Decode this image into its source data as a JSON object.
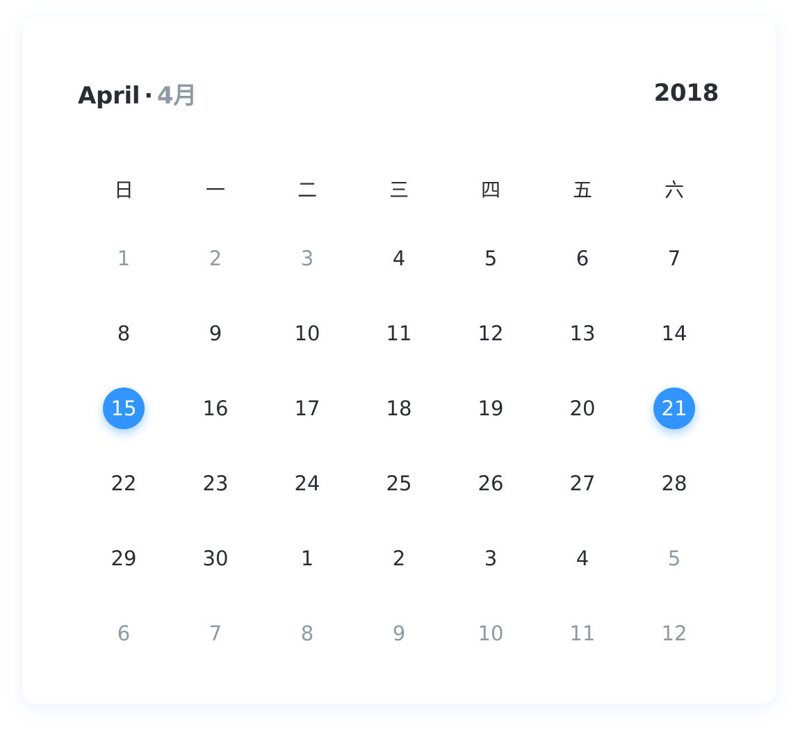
{
  "header": {
    "month": "April",
    "separator": "·",
    "month_cn": "4月",
    "year": "2018"
  },
  "weekdays": [
    "日",
    "一",
    "二",
    "三",
    "四",
    "五",
    "六"
  ],
  "weeks": [
    [
      {
        "label": "1",
        "muted": true,
        "selected": false
      },
      {
        "label": "2",
        "muted": true,
        "selected": false
      },
      {
        "label": "3",
        "muted": true,
        "selected": false
      },
      {
        "label": "4",
        "muted": false,
        "selected": false
      },
      {
        "label": "5",
        "muted": false,
        "selected": false
      },
      {
        "label": "6",
        "muted": false,
        "selected": false
      },
      {
        "label": "7",
        "muted": false,
        "selected": false
      }
    ],
    [
      {
        "label": "8",
        "muted": false,
        "selected": false
      },
      {
        "label": "9",
        "muted": false,
        "selected": false
      },
      {
        "label": "10",
        "muted": false,
        "selected": false
      },
      {
        "label": "11",
        "muted": false,
        "selected": false
      },
      {
        "label": "12",
        "muted": false,
        "selected": false
      },
      {
        "label": "13",
        "muted": false,
        "selected": false
      },
      {
        "label": "14",
        "muted": false,
        "selected": false
      }
    ],
    [
      {
        "label": "15",
        "muted": false,
        "selected": true
      },
      {
        "label": "16",
        "muted": false,
        "selected": false
      },
      {
        "label": "17",
        "muted": false,
        "selected": false
      },
      {
        "label": "18",
        "muted": false,
        "selected": false
      },
      {
        "label": "19",
        "muted": false,
        "selected": false
      },
      {
        "label": "20",
        "muted": false,
        "selected": false
      },
      {
        "label": "21",
        "muted": false,
        "selected": true
      }
    ],
    [
      {
        "label": "22",
        "muted": false,
        "selected": false
      },
      {
        "label": "23",
        "muted": false,
        "selected": false
      },
      {
        "label": "24",
        "muted": false,
        "selected": false
      },
      {
        "label": "25",
        "muted": false,
        "selected": false
      },
      {
        "label": "26",
        "muted": false,
        "selected": false
      },
      {
        "label": "27",
        "muted": false,
        "selected": false
      },
      {
        "label": "28",
        "muted": false,
        "selected": false
      }
    ],
    [
      {
        "label": "29",
        "muted": false,
        "selected": false
      },
      {
        "label": "30",
        "muted": false,
        "selected": false
      },
      {
        "label": "1",
        "muted": false,
        "selected": false
      },
      {
        "label": "2",
        "muted": false,
        "selected": false
      },
      {
        "label": "3",
        "muted": false,
        "selected": false
      },
      {
        "label": "4",
        "muted": false,
        "selected": false
      },
      {
        "label": "5",
        "muted": true,
        "selected": false
      }
    ],
    [
      {
        "label": "6",
        "muted": true,
        "selected": false
      },
      {
        "label": "7",
        "muted": true,
        "selected": false
      },
      {
        "label": "8",
        "muted": true,
        "selected": false
      },
      {
        "label": "9",
        "muted": true,
        "selected": false
      },
      {
        "label": "10",
        "muted": true,
        "selected": false
      },
      {
        "label": "11",
        "muted": true,
        "selected": false
      },
      {
        "label": "12",
        "muted": true,
        "selected": false
      }
    ]
  ],
  "colors": {
    "accent": "#3294ff",
    "text": "#2a2d33",
    "muted": "#8e9aa3"
  }
}
